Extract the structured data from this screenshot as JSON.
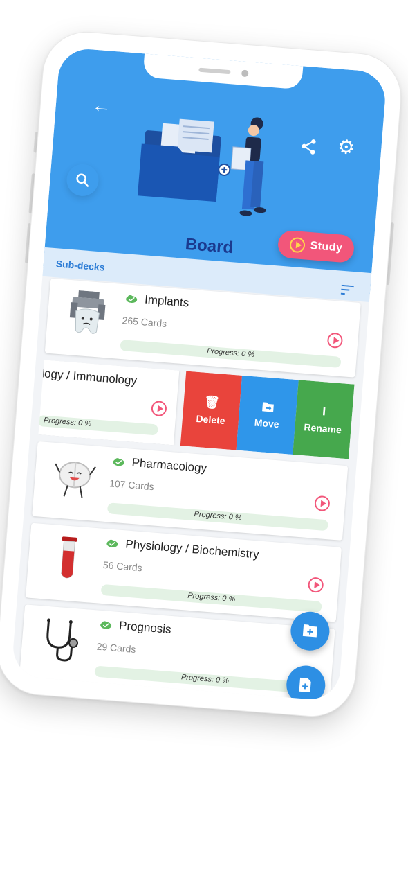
{
  "header": {
    "title": "Board",
    "study_label": "Study",
    "subdecks_label": "Sub-decks"
  },
  "decks": [
    {
      "name": "Implants",
      "count": "265 Cards",
      "progress_label": "Progress: 0 %",
      "progress": 0,
      "thumb": "tooth-claw-icon"
    },
    {
      "name": "logy / Immunology",
      "progress_label": "Progress: 0 %",
      "progress": 0
    },
    {
      "name": "Pharmacology",
      "count": "107 Cards",
      "progress_label": "Progress: 0 %",
      "progress": 0,
      "thumb": "pill-character-icon"
    },
    {
      "name": "Physiology  / Biochemistry",
      "count": "56 Cards",
      "progress_label": "Progress: 0 %",
      "progress": 0,
      "thumb": "test-tube-icon"
    },
    {
      "name": "Prognosis",
      "count": "29 Cards",
      "progress_label": "Progress: 0 %",
      "progress": 0,
      "thumb": "stethoscope-icon"
    }
  ],
  "swipe_actions": {
    "delete": "Delete",
    "move": "Move",
    "rename": "Rename"
  },
  "colors": {
    "header": "#3e9ded",
    "study": "#f2567a",
    "delete": "#e9443c",
    "move": "#2f96ea",
    "rename": "#46a84d",
    "progress_track": "#e3f2e4",
    "title": "#1b3a8f"
  }
}
